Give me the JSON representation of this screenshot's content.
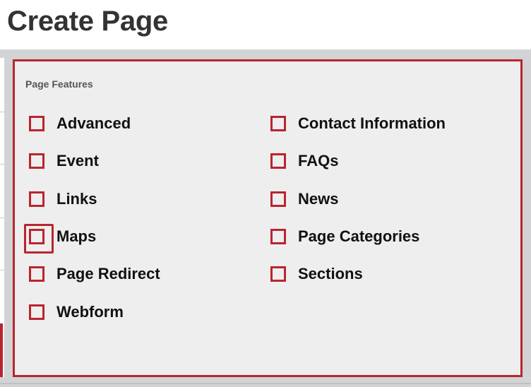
{
  "page": {
    "title": "Create Page"
  },
  "features": {
    "legend": "Page Features",
    "left_column": [
      {
        "label": "Advanced",
        "checked": false,
        "focused": false
      },
      {
        "label": "Event",
        "checked": false,
        "focused": false
      },
      {
        "label": "Links",
        "checked": false,
        "focused": false
      },
      {
        "label": "Maps",
        "checked": false,
        "focused": true
      },
      {
        "label": "Page Redirect",
        "checked": false,
        "focused": false
      },
      {
        "label": "Webform",
        "checked": false,
        "focused": false
      }
    ],
    "right_column": [
      {
        "label": "Contact Information",
        "checked": false,
        "focused": false
      },
      {
        "label": "FAQs",
        "checked": false,
        "focused": false
      },
      {
        "label": "News",
        "checked": false,
        "focused": false
      },
      {
        "label": "Page Categories",
        "checked": false,
        "focused": false
      },
      {
        "label": "Sections",
        "checked": false,
        "focused": false
      }
    ]
  },
  "colors": {
    "accent": "#b9252f",
    "panel": "#eeeeee",
    "band": "#d2d3d4",
    "title": "#333333"
  }
}
